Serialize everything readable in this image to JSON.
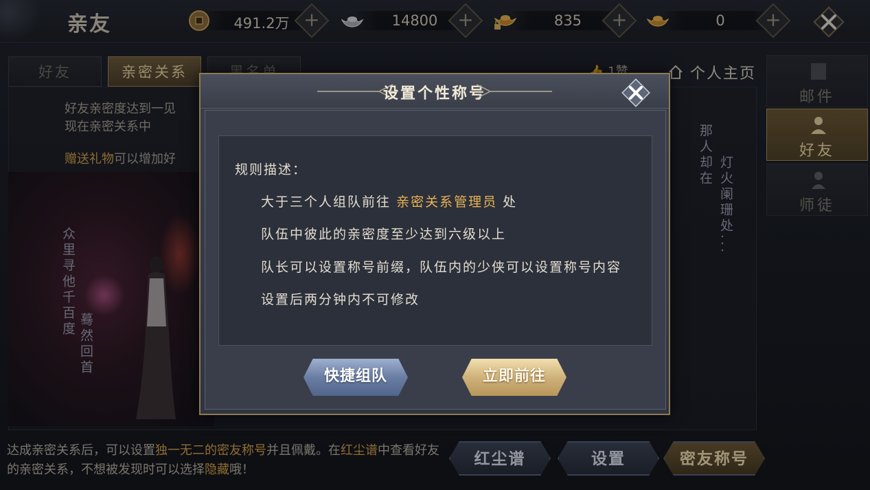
{
  "header": {
    "title": "亲友",
    "currencies": [
      {
        "icon": "copper-coin-icon",
        "value": "491.2万"
      },
      {
        "icon": "silver-ingot-icon",
        "value": "14800"
      },
      {
        "icon": "locked-gold-ingot-icon",
        "value": "835"
      },
      {
        "icon": "gold-ingot-icon",
        "value": "0"
      }
    ],
    "plus_label": "+"
  },
  "tabs": [
    {
      "label": "好友",
      "active": false
    },
    {
      "label": "亲密关系",
      "active": true
    },
    {
      "label": "黑名单",
      "active": false
    }
  ],
  "main": {
    "info_line1": "好友亲密度达到一见",
    "info_line2": "现在亲密关系中",
    "gift_highlight": "赠送礼物",
    "gift_rest": "可以增加好",
    "poem_left_col1": "众里寻他千百度",
    "poem_left_col2": "蓦然回首",
    "poem_right_col1": "那人却在",
    "poem_right_col2": "灯火阑珊处...",
    "like_count": "1赞",
    "home_label": "个人主页"
  },
  "side_nav": [
    {
      "label": "邮件",
      "icon": "mail-icon",
      "active": false
    },
    {
      "label": "好友",
      "icon": "friend-icon",
      "active": true
    },
    {
      "label": "师徒",
      "icon": "master-icon",
      "active": false
    }
  ],
  "bottom": {
    "t1": "达成亲密关系后，可以设置",
    "t2": "独一无二的密友称号",
    "t3": "并且佩戴。在",
    "t4": "红尘谱",
    "t5": "中查看好友的亲密关系，不想被发现时可以选择",
    "t6": "隐藏",
    "t7": "哦！",
    "buttons": [
      {
        "label": "红尘谱"
      },
      {
        "label": "设置"
      },
      {
        "label": "密友称号"
      }
    ]
  },
  "modal": {
    "title": "设置个性称号",
    "rule_title": "规则描述：",
    "rule1_pre": "大于三个人组队前往",
    "rule1_hl": "亲密关系管理员",
    "rule1_post": "处",
    "rule2": "队伍中彼此的亲密度至少达到六级以上",
    "rule3": "队长可以设置称号前缀，队伍内的少侠可以设置称号内容",
    "rule4": "设置后两分钟内不可修改",
    "btn_team": "快捷组队",
    "btn_go": "立即前往"
  },
  "colors": {
    "highlight": "#e8b455",
    "gold_tab": "#6d5b3a",
    "modal_bg": "#3b3f4b"
  }
}
